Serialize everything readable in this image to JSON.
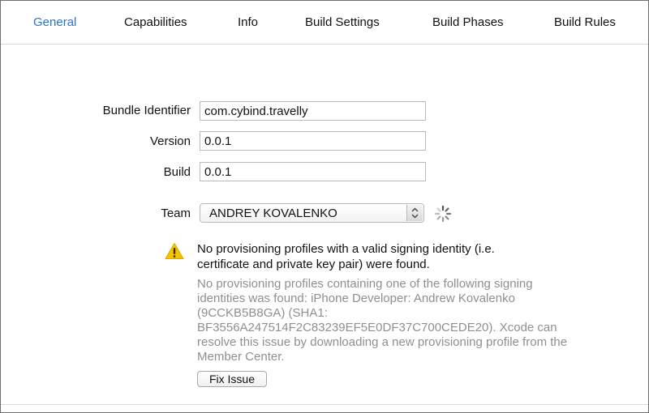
{
  "tabs": [
    {
      "label": "General",
      "active": true
    },
    {
      "label": "Capabilities",
      "active": false
    },
    {
      "label": "Info",
      "active": false
    },
    {
      "label": "Build Settings",
      "active": false
    },
    {
      "label": "Build Phases",
      "active": false
    },
    {
      "label": "Build Rules",
      "active": false
    }
  ],
  "identity": {
    "bundle_identifier_label": "Bundle Identifier",
    "bundle_identifier_value": "com.cybind.travelly",
    "version_label": "Version",
    "version_value": "0.0.1",
    "build_label": "Build",
    "build_value": "0.0.1",
    "team_label": "Team",
    "team_value": "ANDREY KOVALENKO"
  },
  "warning": {
    "icon": "warning-triangle-icon",
    "title": "No provisioning profiles with a valid signing identity (i.e. certificate and private key pair) were found.",
    "detail": "No provisioning profiles containing one of the following signing identities was found: iPhone Developer: Andrew Kovalenko (9CCKB5B8GA) (SHA1: BF3556A247514F2C83239EF5E0DF37C700CEDE20).  Xcode can resolve this issue by downloading a new provisioning profile from the Member Center.",
    "fix_button_label": "Fix Issue"
  },
  "colors": {
    "active_tab": "#2a73c9",
    "warning_yellow": "#f5c400",
    "detail_text": "#8f8f8f"
  }
}
